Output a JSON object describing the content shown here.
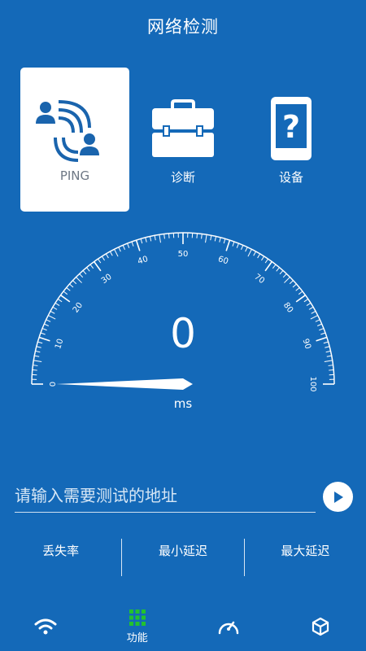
{
  "header": {
    "title": "网络检测"
  },
  "modes": [
    {
      "label": "PING",
      "icon": "ping-network-icon",
      "active": true
    },
    {
      "label": "诊断",
      "icon": "toolbox-icon",
      "active": false
    },
    {
      "label": "设备",
      "icon": "phone-question-icon",
      "active": false
    }
  ],
  "gauge": {
    "value": "0",
    "unit": "ms",
    "min": 0,
    "max": 100,
    "tick_labels": [
      "0",
      "10",
      "20",
      "30",
      "40",
      "50",
      "60",
      "70",
      "80",
      "90",
      "100"
    ]
  },
  "address": {
    "placeholder": "请输入需要测试的地址",
    "value": ""
  },
  "stats": {
    "loss_label": "丢失率",
    "min_label": "最小延迟",
    "max_label": "最大延迟"
  },
  "tabs": [
    {
      "icon": "wifi-icon",
      "label": ""
    },
    {
      "icon": "grid-icon",
      "label": "功能",
      "active": true
    },
    {
      "icon": "speedometer-icon",
      "label": ""
    },
    {
      "icon": "cube-icon",
      "label": ""
    }
  ],
  "colors": {
    "background": "#1469b8",
    "accent_green": "#22c22e",
    "card": "#ffffff"
  }
}
